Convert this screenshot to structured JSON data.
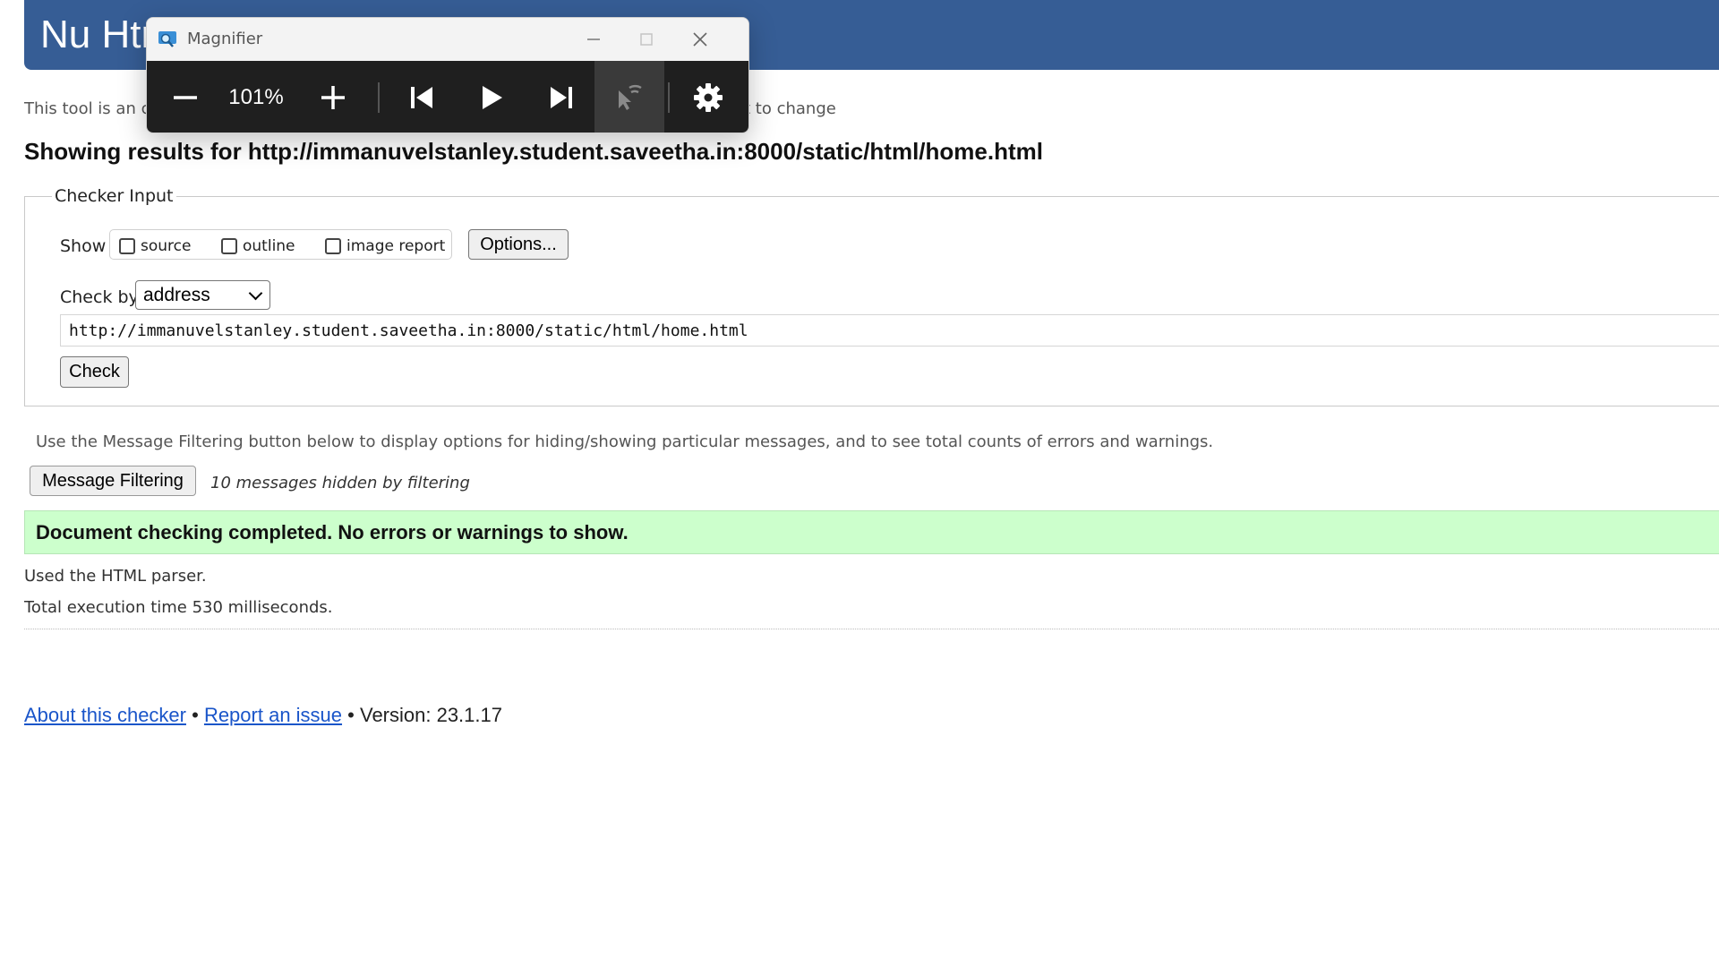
{
  "header": {
    "title": "Nu Html Checker"
  },
  "intro": {
    "visible_start": "This tool is an c",
    "visible_end": "t to change"
  },
  "results": {
    "heading": "Showing results for http://immanuvelstanley.student.saveetha.in:8000/static/html/home.html"
  },
  "checker_input": {
    "legend": "Checker Input",
    "show_label": "Show",
    "checkboxes": [
      {
        "label": "source",
        "checked": false
      },
      {
        "label": "outline",
        "checked": false
      },
      {
        "label": "image report",
        "checked": false
      }
    ],
    "options_button": "Options...",
    "check_by_label": "Check by",
    "check_by_value": "address",
    "url_value": "http://immanuvelstanley.student.saveetha.in:8000/static/html/home.html",
    "check_button": "Check"
  },
  "filtering": {
    "hint": "Use the Message Filtering button below to display options for hiding/showing particular messages, and to see total counts of errors and warnings.",
    "button": "Message Filtering",
    "hidden_count": "10 messages hidden by filtering"
  },
  "status": {
    "success": "Document checking completed. No errors or warnings to show.",
    "parser": "Used the HTML parser.",
    "execution_time": "Total execution time 530 milliseconds."
  },
  "footer": {
    "about_link": "About this checker",
    "separator": "•",
    "report_link": "Report an issue",
    "version": "Version: 23.1.17"
  },
  "magnifier": {
    "title": "Magnifier",
    "zoom_level": "101%",
    "icons": [
      "zoom-out-icon",
      "zoom-in-icon",
      "skip-previous-icon",
      "play-icon",
      "skip-next-icon",
      "read-from-here-icon",
      "settings-icon"
    ]
  },
  "colors": {
    "header_bg": "#365d95",
    "success_bg": "#ccffcc",
    "link": "#1a55c9",
    "magnifier_toolbar": "#1f1f1f"
  }
}
